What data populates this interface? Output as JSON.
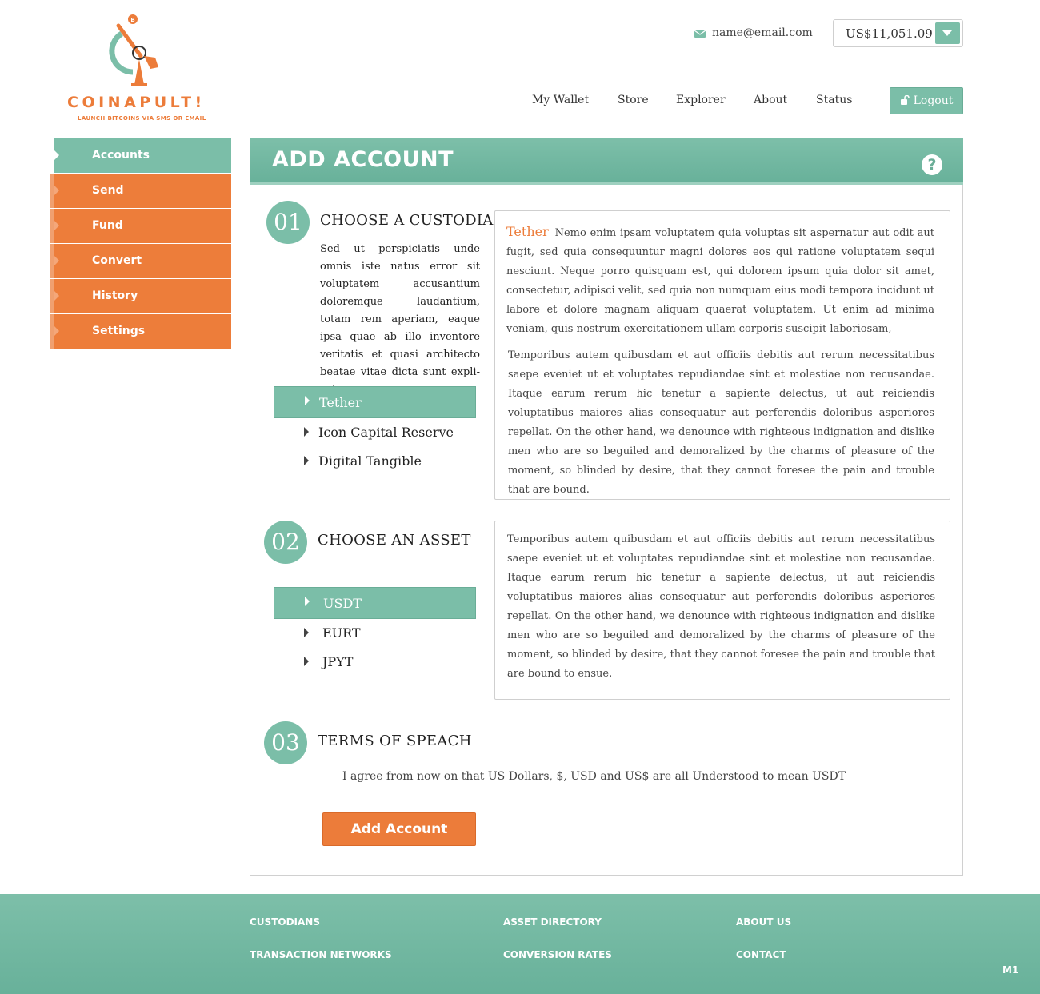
{
  "brand": {
    "name": "COINAPULT!",
    "tagline": "LAUNCH BITCOINS VIA SMS OR EMAIL",
    "colors": {
      "orange": "#ec7c3a",
      "green": "#7bbea8"
    }
  },
  "header": {
    "email": "name@email.com",
    "balance": "US$11,051.09",
    "nav": [
      "My Wallet",
      "Store",
      "Explorer",
      "About",
      "Status"
    ],
    "logout_label": "Logout"
  },
  "sidebar": {
    "items": [
      {
        "label": "Accounts",
        "active": true
      },
      {
        "label": "Send"
      },
      {
        "label": "Fund"
      },
      {
        "label": "Convert"
      },
      {
        "label": "History"
      },
      {
        "label": "Settings"
      }
    ]
  },
  "panel": {
    "title": "ADD ACCOUNT",
    "help_icon": "question-circle-icon"
  },
  "steps": [
    {
      "number": "01",
      "title": "CHOOSE A CUSTODIAN",
      "intro": "Sed ut perspiciatis unde omnis iste natus error sit voluptatem accusantium doloremque lau­dantium, totam rem aperiam, eaque ipsa quae ab illo inven­tore veritatis et quasi architecto beatae vitae dicta sunt expli­cabo",
      "options": [
        "Tether",
        "Icon Capital Reserve",
        "Digital Tangible"
      ],
      "selected": "Tether",
      "description": {
        "brand": "Tether",
        "para1": "Nemo enim ipsam voluptatem quia voluptas sit aspernatur aut odit aut fugit, sed quia consequuntur magni dolores eos qui ratione voluptatem sequi nesciunt. Neque porro quisquam est, qui dolorem ipsum quia dolor sit amet, consectetur, adipi­sci velit, sed quia non numquam eius modi tempora incidunt ut labore et dolore magnam aliquam quaerat voluptatem. Ut enim ad minima veniam, quis nostrum exer­citationem ullam corporis suscipit laboriosam,",
        "para2": "Temporibus autem quibusdam et aut officiis debitis aut rerum necessitatibus saepe eveniet ut et voluptates repudiandae sint et molestiae non recusandae. Itaque earum rerum hic tenetur a sapiente delectus, ut aut reiciendis voluptatibus maiores alias con­sequatur aut perferendis doloribus asperiores repellat. On the other hand, we denounce with righteous indignation and dislike men who are so beguiled and demor­alized by the charms of pleasure of the moment, so blinded by desire, that they cannot foresee the pain and trouble that are bound."
      }
    },
    {
      "number": "02",
      "title": "CHOOSE AN ASSET",
      "options": [
        "USDT",
        "EURT",
        "JPYT"
      ],
      "selected": "USDT",
      "description": {
        "para1": "Temporibus autem quibusdam et aut officiis debitis aut rerum necessitatibus saepe eveniet ut et voluptates repudiandae sint et molestiae non recusandae. Itaque earum rerum hic tenetur a sapiente delectus, ut aut reiciendis voluptatibus maiores alias con­sequatur aut perferendis doloribus asperiores repellat. On the other hand, we denounce with righteous indignation and dislike men who are so beguiled and demor­alized by the charms of pleasure of the moment, so blinded by desire, that they cannot foresee the pain and trouble that are bound to ensue."
      }
    },
    {
      "number": "03",
      "title": "TERMS OF SPEACH",
      "terms": "I agree from now on that US Dollars, $, USD and US$ are all Understood to mean USDT"
    }
  ],
  "submit_label": "Add Account",
  "footer": {
    "col1": [
      "CUSTODIANS",
      "TRANSACTION NETWORKS"
    ],
    "col2": [
      "ASSET DIRECTORY",
      "CONVERSION RATES"
    ],
    "col3": [
      "ABOUT US",
      "CONTACT"
    ],
    "version": "M1"
  }
}
